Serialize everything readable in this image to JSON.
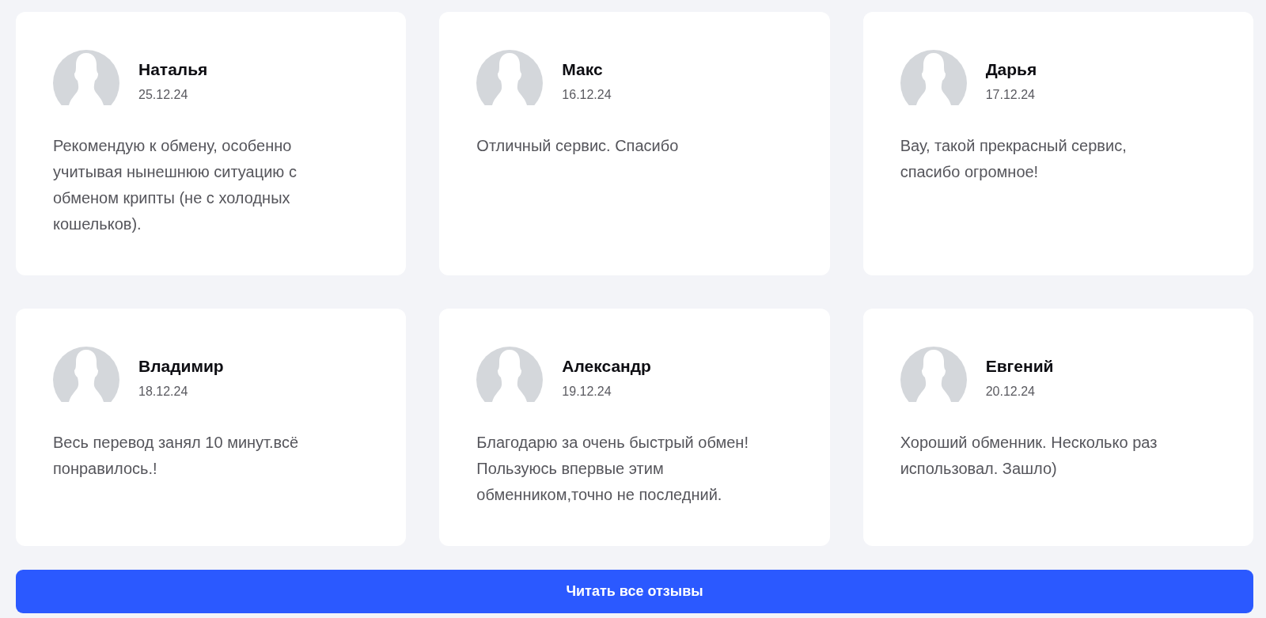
{
  "reviews": [
    {
      "name": "Наталья",
      "date": "25.12.24",
      "text": "Рекомендую к обмену, особенно учитывая нынешнюю ситуацию с обменом крипты (не с холодных кошельков)."
    },
    {
      "name": "Макс",
      "date": "16.12.24",
      "text": "Отличный сервис. Спасибо"
    },
    {
      "name": "Дарья",
      "date": "17.12.24",
      "text": "Вау, такой прекрасный сервис, спасибо огромное!"
    },
    {
      "name": "Владимир",
      "date": "18.12.24",
      "text": "Весь перевод занял 10 минут.всё понравилось.!"
    },
    {
      "name": "Александр",
      "date": "19.12.24",
      "text": "Благодарю за очень быстрый обмен! Пользуюсь впервые этим обменником,точно не последний."
    },
    {
      "name": "Евгений",
      "date": "20.12.24",
      "text": "Хороший обменник. Несколько раз использовал. Зашло)"
    }
  ],
  "read_all_button": {
    "label": "Читать все отзывы"
  }
}
